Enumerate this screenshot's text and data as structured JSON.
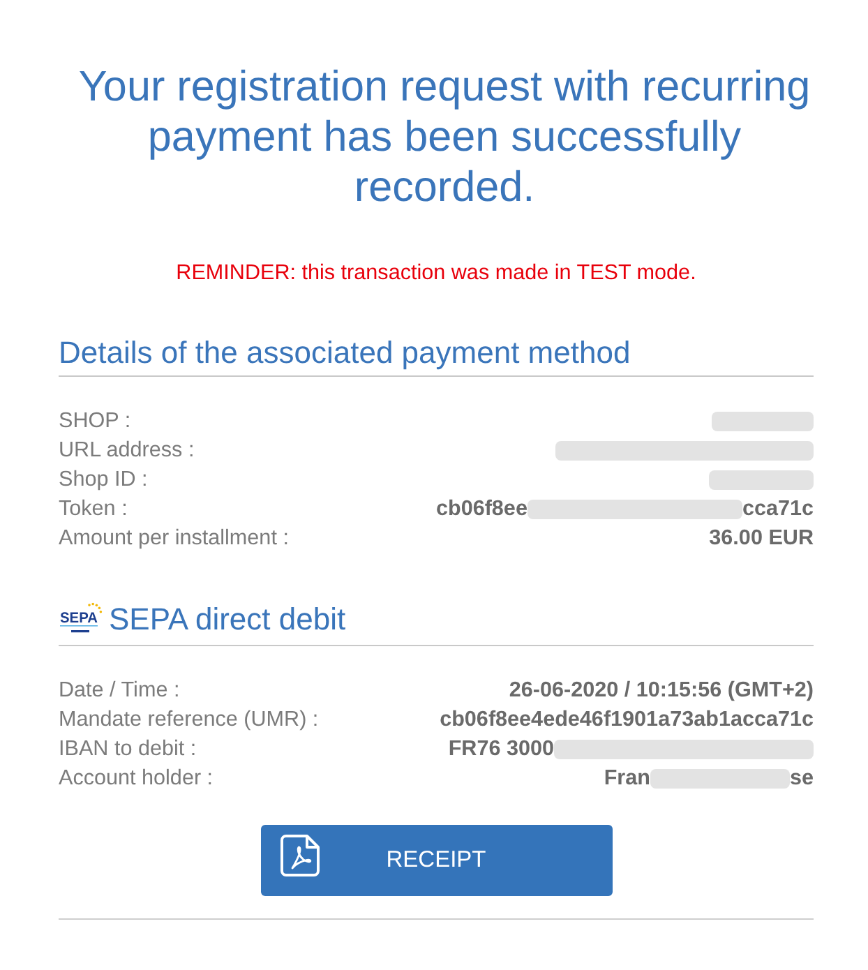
{
  "title": "Your registration request with recurring payment has been successfully recorded.",
  "notice": "REMINDER: this transaction was made in TEST mode.",
  "sections": [
    {
      "kind": "plain",
      "heading": "Details of the associated payment method",
      "rows": [
        {
          "label": "SHOP :",
          "value": [
            {
              "kind": "redacted"
            }
          ]
        },
        {
          "label": "URL address :",
          "value": [
            {
              "kind": "redacted"
            }
          ]
        },
        {
          "label": "Shop ID :",
          "value": [
            {
              "kind": "redacted"
            }
          ]
        },
        {
          "label": "Token :",
          "value": [
            {
              "kind": "text",
              "text": "cb06f8ee"
            },
            {
              "kind": "redacted"
            },
            {
              "kind": "text",
              "text": "cca71c"
            }
          ]
        },
        {
          "label": "Amount per installment :",
          "value": [
            {
              "kind": "text",
              "text": "36.00 EUR"
            }
          ]
        }
      ]
    },
    {
      "kind": "sepa",
      "logo_text": "SEPA",
      "heading": "SEPA direct debit",
      "rows": [
        {
          "label": "Date / Time :",
          "value": [
            {
              "kind": "text",
              "text": "26-06-2020 / 10:15:56 (GMT+2)"
            }
          ]
        },
        {
          "label": "Mandate reference (UMR) :",
          "value": [
            {
              "kind": "text",
              "text": "cb06f8ee4ede46f1901a73ab1acca71c"
            }
          ]
        },
        {
          "label": "IBAN to debit :",
          "value": [
            {
              "kind": "text",
              "text": "FR76 3000"
            },
            {
              "kind": "redacted"
            }
          ]
        },
        {
          "label": "Account holder :",
          "value": [
            {
              "kind": "text",
              "text": "Fran"
            },
            {
              "kind": "redacted"
            },
            {
              "kind": "text",
              "text": "se"
            }
          ]
        }
      ]
    }
  ],
  "receipt_button": {
    "label": "RECEIPT"
  }
}
